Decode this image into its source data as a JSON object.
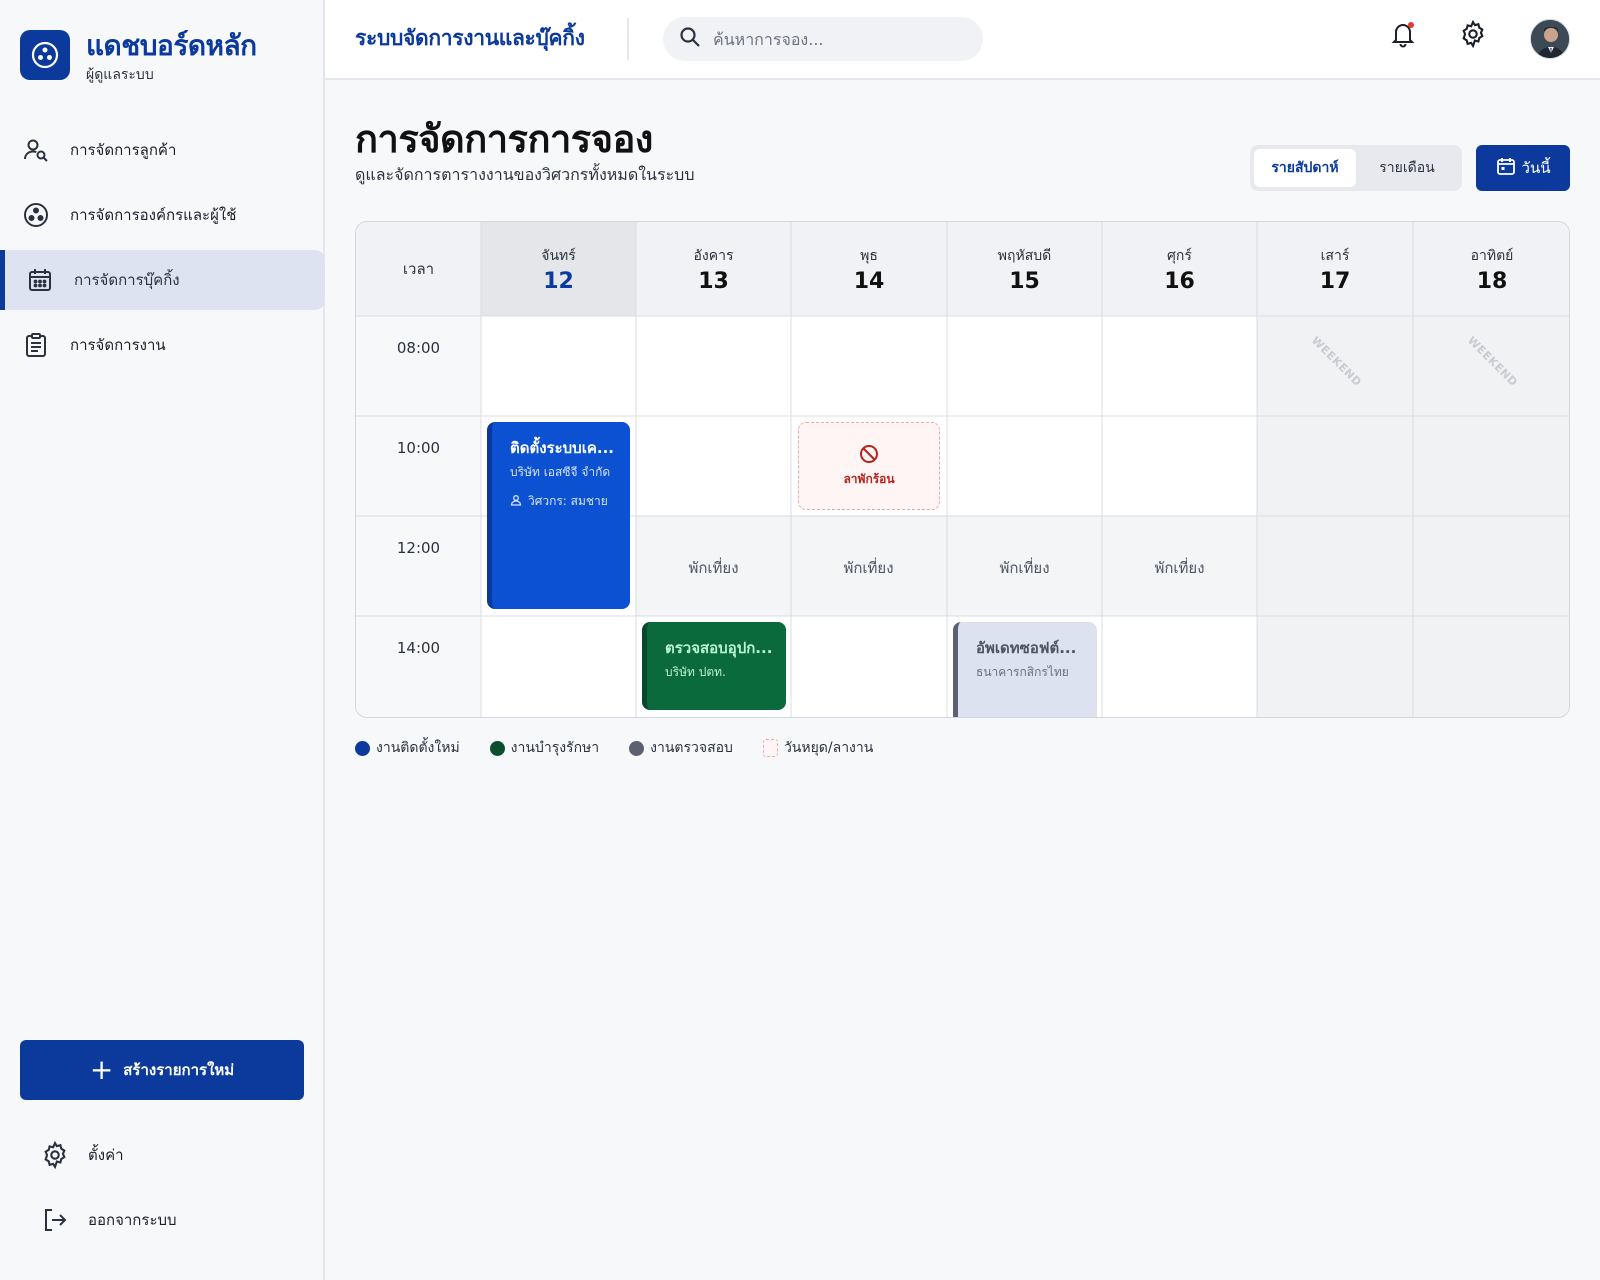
{
  "brand": {
    "title": "แดชบอร์ดหลัก",
    "subtitle": "ผู้ดูแลระบบ",
    "logo_icon": "hub-icon"
  },
  "nav": [
    {
      "label": "การจัดการลูกค้า",
      "icon": "person-search-icon",
      "active": false
    },
    {
      "label": "การจัดการองค์กรและผู้ใช้",
      "icon": "hub-icon",
      "active": false
    },
    {
      "label": "การจัดการบุ๊คกิ้ง",
      "icon": "calendar-icon",
      "active": true
    },
    {
      "label": "การจัดการงาน",
      "icon": "clipboard-icon",
      "active": false
    }
  ],
  "create_button": {
    "label": "สร้างรายการใหม่",
    "icon": "plus-icon"
  },
  "bottom_nav": {
    "settings": "ตั้งค่า",
    "logout": "ออกจากระบบ"
  },
  "header": {
    "app_title": "ระบบจัดการงานและบุ๊คกิ้ง",
    "search_placeholder": "ค้นหาการจอง...",
    "icons": [
      "bell-icon",
      "gear-icon",
      "avatar"
    ]
  },
  "page": {
    "title": "การจัดการการจอง",
    "subtitle": "ดูและจัดการตารางงานของวิศวกรทั้งหมดในระบบ",
    "view_options": [
      "รายสัปดาห์",
      "รายเดือน"
    ],
    "selected_view": "รายสัปดาห์",
    "today_button": "วันนี้"
  },
  "calendar": {
    "time_header": "เวลา",
    "days": [
      {
        "name": "จันทร์",
        "num": "12",
        "today": true
      },
      {
        "name": "อังคาร",
        "num": "13"
      },
      {
        "name": "พุธ",
        "num": "14"
      },
      {
        "name": "พฤหัสบดี",
        "num": "15"
      },
      {
        "name": "ศุกร์",
        "num": "16"
      },
      {
        "name": "เสาร์",
        "num": "17",
        "weekend": true
      },
      {
        "name": "อาทิตย์",
        "num": "18",
        "weekend": true
      }
    ],
    "times": [
      "08:00",
      "10:00",
      "12:00",
      "14:00"
    ],
    "weekend_label": "WEEKEND",
    "lunch_label": "พักเที่ยง",
    "events": [
      {
        "title": "ติดตั้งระบบเค...",
        "company": "บริษัท เอสซีจี จำกัด",
        "engineer": "วิศวกร: สมชาย",
        "type": "install",
        "color": "#0b51d1"
      },
      {
        "title": "ตรวจสอบอุปก...",
        "company": "บริษัท ปตท.",
        "type": "maintenance",
        "color": "#0a6a3c"
      },
      {
        "title": "อัพเดทซอฟต์...",
        "company": "ธนาคารกสิกรไทย",
        "type": "inspection",
        "color": "#5b6170"
      }
    ],
    "leave": {
      "label": "ลาพักร้อน",
      "icon": "block-icon"
    }
  },
  "legend": [
    {
      "label": "งานติดตั้งใหม่",
      "color": "#0b3a9c"
    },
    {
      "label": "งานบำรุงรักษา",
      "color": "#0a4f30"
    },
    {
      "label": "งานตรวจสอบ",
      "color": "#5b6170"
    },
    {
      "label": "วันหยุด/ลางาน",
      "color": "#f0a7a7"
    }
  ]
}
